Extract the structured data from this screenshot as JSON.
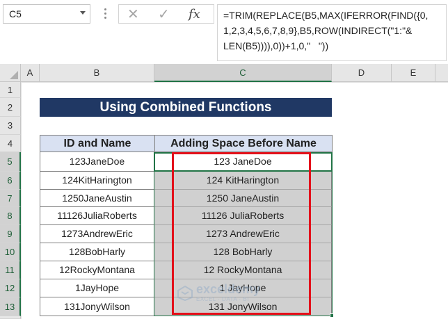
{
  "formula_bar": {
    "name_box": "C5",
    "cancel_icon": "✕",
    "enter_icon": "✓",
    "fx_label": "fx",
    "formula_lines": [
      "=TRIM(REPLACE(B5,MAX(IFERROR(FIND({0,",
      "1,2,3,4,5,6,7,8,9},B5,ROW(INDIRECT(\"1:\"&",
      "LEN(B5)))),0))+1,0,\"   \"))"
    ]
  },
  "columns": [
    "A",
    "B",
    "C",
    "D",
    "E"
  ],
  "rows": [
    "1",
    "2",
    "3",
    "4",
    "5",
    "6",
    "7",
    "8",
    "9",
    "10",
    "11",
    "12",
    "13"
  ],
  "sheet": {
    "title": "Using Combined Functions",
    "headers": {
      "col_b": "ID and Name",
      "col_c": "Adding Space Before Name"
    },
    "data_rows": [
      {
        "input": "123JaneDoe",
        "output": "123 JaneDoe"
      },
      {
        "input": "124KitHarington",
        "output": "124 KitHarington"
      },
      {
        "input": "1250JaneAustin",
        "output": "1250 JaneAustin"
      },
      {
        "input": "11126JuliaRoberts",
        "output": "11126 JuliaRoberts"
      },
      {
        "input": "1273AndrewEric",
        "output": "1273 AndrewEric"
      },
      {
        "input": "128BobHarly",
        "output": "128 BobHarly"
      },
      {
        "input": "12RockyMontana",
        "output": "12 RockyMontana"
      },
      {
        "input": "1JayHope",
        "output": "1 JayHope"
      },
      {
        "input": "131JonyWilson",
        "output": "131 JonyWilson"
      }
    ]
  },
  "watermark": {
    "name": "exceldemy",
    "tagline": "EXCEL · DATA · BI"
  },
  "colors": {
    "title_bg": "#203864",
    "header_bg": "#d9e1f2",
    "selection": "#217346",
    "highlight_box": "#e3101a",
    "filled_cells": "#d0d0d0"
  }
}
